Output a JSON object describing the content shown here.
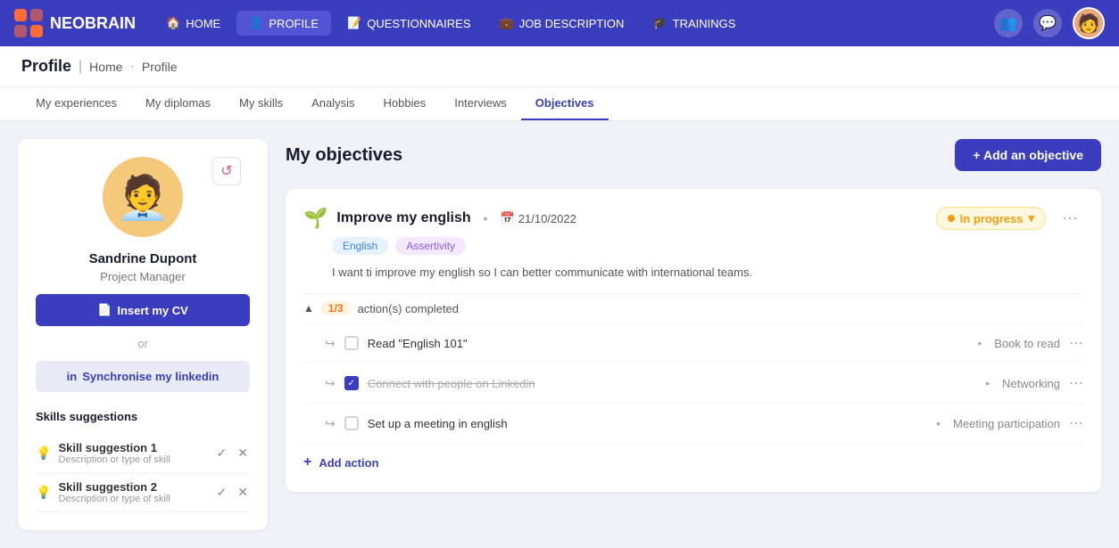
{
  "app": {
    "name": "NEOBRAIN"
  },
  "topnav": {
    "items": [
      {
        "id": "home",
        "label": "HOME",
        "icon": "🏠",
        "active": false
      },
      {
        "id": "profile",
        "label": "PROFILE",
        "icon": "👤",
        "active": true
      },
      {
        "id": "questionnaires",
        "label": "QUESTIONNAIRES",
        "icon": "📝",
        "active": false
      },
      {
        "id": "job-description",
        "label": "JOB DESCRIPTION",
        "icon": "💼",
        "active": false
      },
      {
        "id": "trainings",
        "label": "TRAININGS",
        "icon": "🎓",
        "active": false
      }
    ]
  },
  "breadcrumb": {
    "title": "Profile",
    "separator": "|",
    "links": [
      "Home",
      "Profile"
    ]
  },
  "subnav": {
    "items": [
      {
        "id": "experiences",
        "label": "My experiences",
        "active": false
      },
      {
        "id": "diplomas",
        "label": "My diplomas",
        "active": false
      },
      {
        "id": "skills",
        "label": "My skills",
        "active": false
      },
      {
        "id": "analysis",
        "label": "Analysis",
        "active": false
      },
      {
        "id": "hobbies",
        "label": "Hobbies",
        "active": false
      },
      {
        "id": "interviews",
        "label": "Interviews",
        "active": false
      },
      {
        "id": "objectives",
        "label": "Objectives",
        "active": true
      }
    ]
  },
  "sidebar": {
    "user": {
      "name": "Sandrine Dupont",
      "role": "Project Manager"
    },
    "buttons": {
      "insert_cv": "Insert my CV",
      "or": "or",
      "sync_linkedin": "Synchronise my linkedin"
    },
    "skills_suggestions": {
      "title": "Skills suggestions",
      "items": [
        {
          "name": "Skill suggestion 1",
          "description": "Description or type of skill"
        },
        {
          "name": "Skill suggestion 2",
          "description": "Description or type of skill"
        }
      ]
    }
  },
  "main": {
    "title": "My objectives",
    "add_button": "+ Add an objective",
    "objectives": [
      {
        "id": "obj1",
        "icon": "🌱",
        "name": "Improve my english",
        "date": "21/10/2022",
        "tags": [
          "English",
          "Assertivity"
        ],
        "description": "I want ti improve my english so I can better communicate with international teams.",
        "status": "In progress",
        "actions_summary": {
          "completed": 1,
          "total": 3,
          "label": "action(s) completed"
        },
        "actions": [
          {
            "id": "a1",
            "name": "Read \"English 101\"",
            "category": "Book to read",
            "completed": false
          },
          {
            "id": "a2",
            "name": "Connect with people on Linkedin",
            "category": "Networking",
            "completed": true
          },
          {
            "id": "a3",
            "name": "Set up a meeting in english",
            "category": "Meeting participation",
            "completed": false
          }
        ],
        "add_action_label": "Add action"
      }
    ]
  }
}
